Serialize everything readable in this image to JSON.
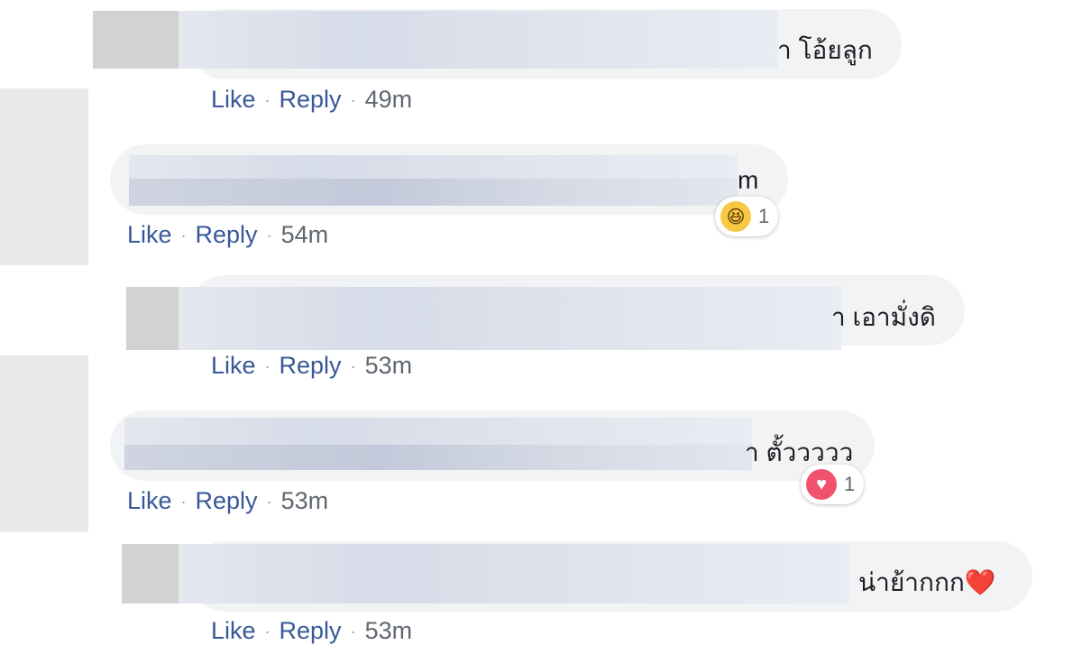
{
  "comments": [
    {
      "text_suffix": "า โอ้ยลูก",
      "like": "Like",
      "reply": "Reply",
      "time": "49m"
    },
    {
      "text_suffix": "m",
      "like": "Like",
      "reply": "Reply",
      "time": "54m",
      "reaction": {
        "icon": "haha-icon",
        "glyph": "😆",
        "count": "1"
      }
    },
    {
      "text_suffix": "า เอามั่งดิ",
      "like": "Like",
      "reply": "Reply",
      "time": "53m"
    },
    {
      "text_suffix": "า ตั้ววววว",
      "like": "Like",
      "reply": "Reply",
      "time": "53m",
      "reaction": {
        "icon": "love-icon",
        "glyph": "♥",
        "count": "1"
      }
    },
    {
      "text_suffix": "น่าย้ากกก❤️",
      "like": "Like",
      "reply": "Reply",
      "time": "53m"
    }
  ],
  "separator": "·"
}
